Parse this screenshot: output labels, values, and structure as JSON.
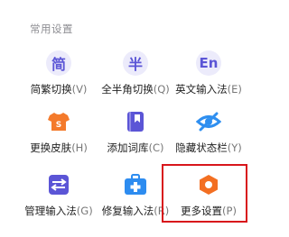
{
  "section_title": "常用设置",
  "items": [
    {
      "id": "jianfan",
      "icon_char": "简",
      "label": "简繁切换",
      "key": "(V)"
    },
    {
      "id": "quanban",
      "icon_char": "半",
      "label": "全半角切换",
      "key": "(Q)"
    },
    {
      "id": "english",
      "icon_char": "En",
      "label": "英文输入法",
      "key": "(E)"
    },
    {
      "id": "skin",
      "icon": "t-shirt-icon",
      "label": "更换皮肤",
      "key": "(H)"
    },
    {
      "id": "dict",
      "icon": "bookmark-book-icon",
      "label": "添加词库",
      "key": "(C)"
    },
    {
      "id": "hidebar",
      "icon": "eye-hidden-icon",
      "label": "隐藏状态栏",
      "key": "(Y)"
    },
    {
      "id": "manage",
      "icon": "sliders-icon",
      "label": "管理输入法",
      "key": "(G)"
    },
    {
      "id": "repair",
      "icon": "medkit-icon",
      "label": "修复输入法",
      "key": "(R)"
    },
    {
      "id": "more",
      "icon": "hexagon-gear-icon",
      "label": "更多设置",
      "key": "(P)"
    }
  ],
  "colors": {
    "accent_purple": "#5b55d6",
    "icon_bg": "#ecebfb",
    "skin_orange": "#f47a2b",
    "more_orange": "#f36f22",
    "hide_blue": "#2f8ff0",
    "repair_blue": "#2d8cf0",
    "highlight_red": "#d8151b"
  }
}
